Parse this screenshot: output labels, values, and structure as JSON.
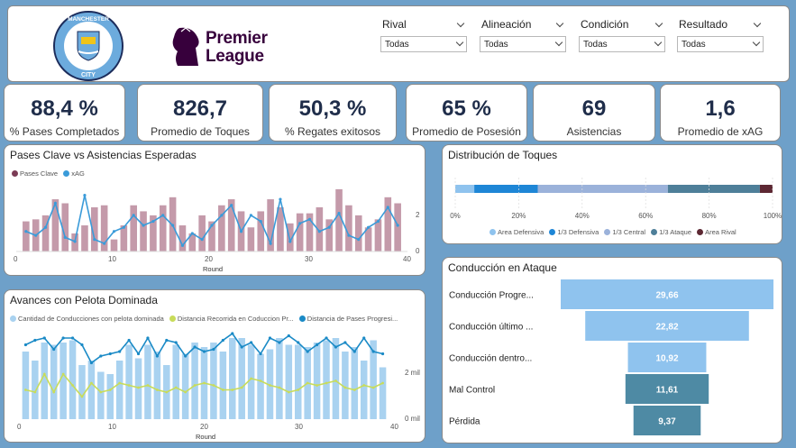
{
  "header": {
    "club_name": "MANCHESTER CITY",
    "league_line1": "Premier",
    "league_line2": "League",
    "filters": [
      {
        "label": "Rival",
        "value": "Todas"
      },
      {
        "label": "Alineación",
        "value": "Todas"
      },
      {
        "label": "Condición",
        "value": "Todas"
      },
      {
        "label": "Resultado",
        "value": "Todas"
      }
    ]
  },
  "kpis": [
    {
      "value": "88,4 %",
      "label": "% Pases Completados"
    },
    {
      "value": "826,7",
      "label": "Promedio de Toques"
    },
    {
      "value": "50,3 %",
      "label": "% Regates exitosos"
    },
    {
      "value": "65 %",
      "label": "Promedio de Posesión"
    },
    {
      "value": "69",
      "label": "Asistencias"
    },
    {
      "value": "1,6",
      "label": "Promedio de xAG"
    }
  ],
  "colors": {
    "background": "#6ea0c9",
    "pases_clave": "#c49aaa",
    "pases_clave_legend": "#7b3b55",
    "xag": "#3a9bd9",
    "bars_light": "#a9d2f0",
    "green_line": "#c8dc5a",
    "blue_line": "#1a8ac6"
  },
  "chart_data": [
    {
      "type": "bar",
      "title": "Pases Clave vs Asistencias Esperadas",
      "xlabel": "Round",
      "legend": [
        "Pases Clave",
        "xAG"
      ],
      "x_ticks": [
        "0",
        "10",
        "20",
        "30",
        "40"
      ],
      "y_right_ticks": [
        "2",
        "0"
      ],
      "x_range": [
        0,
        40
      ],
      "y_range": [
        0,
        3.5
      ],
      "series": [
        {
          "name": "Pases Clave",
          "values": [
            1.5,
            1.6,
            1.8,
            2.6,
            2.4,
            0.9,
            1.3,
            2.2,
            2.3,
            0.6,
            1.3,
            2.3,
            2.0,
            1.8,
            2.3,
            2.7,
            1.3,
            0.9,
            1.8,
            1.5,
            2.3,
            2.6,
            2.0,
            1.2,
            2.0,
            2.6,
            2.2,
            1.4,
            1.9,
            1.9,
            2.2,
            1.6,
            3.1,
            2.3,
            1.8,
            1.2,
            1.6,
            2.7,
            2.4
          ]
        },
        {
          "name": "xAG",
          "values": [
            1.0,
            0.8,
            1.2,
            2.4,
            0.7,
            0.5,
            2.8,
            0.6,
            0.4,
            1.0,
            1.2,
            1.8,
            1.3,
            1.5,
            1.8,
            1.3,
            0.3,
            0.9,
            0.6,
            1.3,
            1.8,
            2.3,
            1.0,
            1.8,
            1.5,
            0.4,
            2.6,
            0.5,
            1.4,
            1.6,
            1.0,
            1.2,
            1.9,
            0.8,
            0.6,
            1.2,
            1.5,
            2.2,
            1.3
          ]
        }
      ]
    },
    {
      "type": "bar",
      "title": "Distribución de Toques",
      "stacked": true,
      "x_ticks": [
        "0%",
        "20%",
        "40%",
        "60%",
        "80%",
        "100%"
      ],
      "segments": [
        {
          "name": "Area Defensiva",
          "value": 6,
          "color": "#8fc3ee"
        },
        {
          "name": "1/3 Defensiva",
          "value": 20,
          "color": "#1e86d6"
        },
        {
          "name": "1/3 Central",
          "value": 41,
          "color": "#9bb2da"
        },
        {
          "name": "1/3 Ataque",
          "value": 29,
          "color": "#4e7f99"
        },
        {
          "name": "Area Rival",
          "value": 4,
          "color": "#5d2833"
        }
      ]
    },
    {
      "type": "bar",
      "title": "Avances con Pelota Dominada",
      "xlabel": "Round",
      "legend": [
        "Cantidad de Conducciones con pelota dominada",
        "Distancia Recorrida en Coduccion Pr...",
        "Distancia de Pases Progresi..."
      ],
      "x_ticks": [
        "0",
        "10",
        "20",
        "30",
        "40"
      ],
      "y_right_ticks": [
        "2 mil",
        "0 mil"
      ],
      "x_range": [
        0,
        40
      ],
      "series": [
        {
          "name": "Cantidad de Conducciones con pelota dominada",
          "values": [
            3.0,
            2.6,
            3.4,
            3.3,
            3.4,
            3.5,
            2.4,
            2.6,
            2.1,
            2.0,
            2.6,
            3.3,
            2.7,
            3.3,
            3.0,
            2.4,
            3.3,
            2.9,
            3.4,
            3.2,
            3.4,
            3.0,
            3.6,
            3.6,
            3.3,
            2.9,
            3.1,
            3.6,
            3.3,
            3.3,
            3.2,
            3.4,
            3.5,
            3.6,
            3.0,
            3.2,
            2.6,
            3.5,
            2.3
          ]
        },
        {
          "name": "Distancia Recorrida en Coduccion Pr...",
          "values": [
            1.3,
            1.2,
            2.0,
            1.2,
            2.0,
            1.5,
            1.0,
            1.6,
            1.2,
            1.3,
            1.6,
            1.5,
            1.4,
            1.5,
            1.3,
            1.2,
            1.4,
            1.2,
            1.5,
            1.6,
            1.5,
            1.3,
            1.3,
            1.4,
            1.8,
            1.7,
            1.5,
            1.4,
            1.2,
            1.3,
            1.6,
            1.5,
            1.6,
            1.7,
            1.4,
            1.3,
            1.5,
            1.4,
            1.6
          ]
        },
        {
          "name": "Distancia de Pases Progresi...",
          "values": [
            3.3,
            3.5,
            3.6,
            3.1,
            3.6,
            3.6,
            3.3,
            2.5,
            2.8,
            2.9,
            3.0,
            3.5,
            2.9,
            3.6,
            2.8,
            3.5,
            3.4,
            2.8,
            3.2,
            3.0,
            3.1,
            3.5,
            3.8,
            3.2,
            3.4,
            2.9,
            3.6,
            3.4,
            3.7,
            3.4,
            3.0,
            3.3,
            3.6,
            3.2,
            3.4,
            3.0,
            3.6,
            3.0,
            2.9
          ]
        }
      ]
    },
    {
      "type": "bar",
      "title": "Conducción en Ataque",
      "orientation": "funnel",
      "categories": [
        "Conducción Progre...",
        "Conducción último ...",
        "Conducción dentro...",
        "Mal Control",
        "Pérdida"
      ],
      "values": [
        29.66,
        22.82,
        10.92,
        11.61,
        9.37
      ],
      "labels": [
        "29,66",
        "22,82",
        "10,92",
        "11,61",
        "9,37"
      ],
      "colors": [
        "#8fc3ee",
        "#8fc3ee",
        "#8fc3ee",
        "#4e8aa4",
        "#4e8aa4"
      ]
    }
  ]
}
